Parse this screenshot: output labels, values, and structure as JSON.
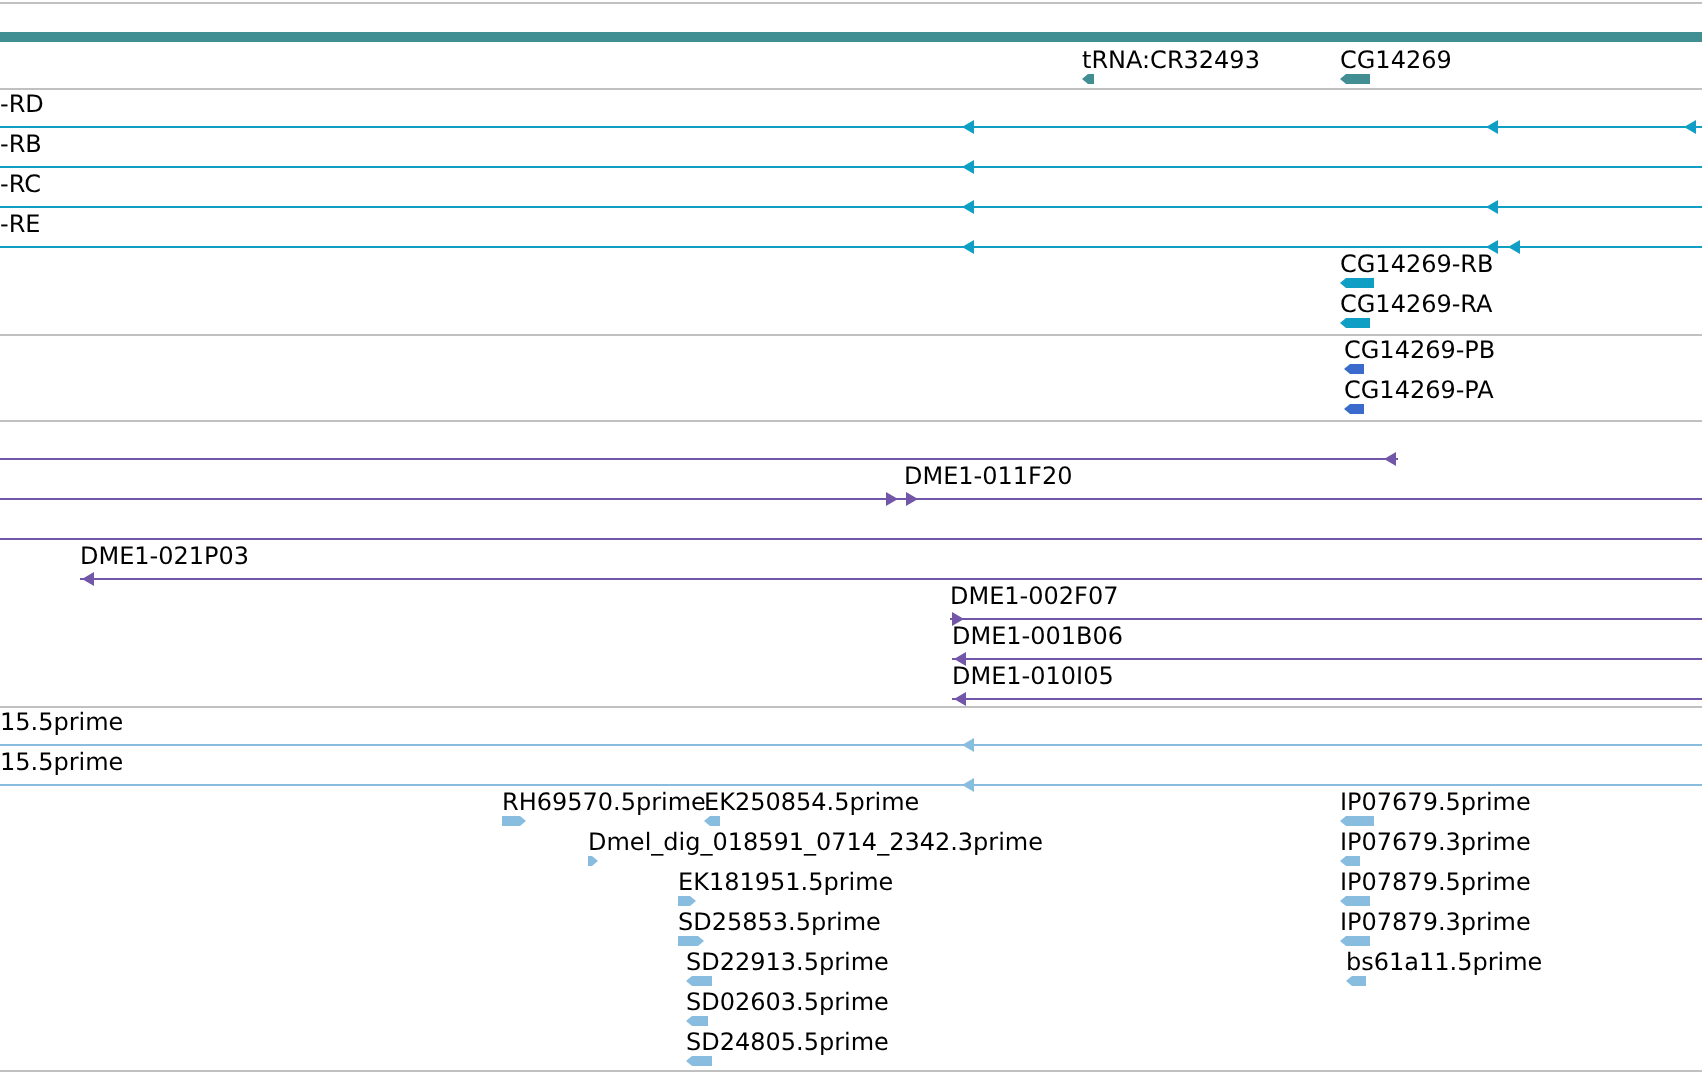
{
  "tracks": [
    {
      "kind": "gene",
      "features": [
        {
          "kind": "block",
          "label": "tRNA:CR32493",
          "reverse": true
        },
        {
          "kind": "block",
          "label": "CG14269",
          "reverse": true
        }
      ]
    },
    {
      "kind": "transcript",
      "features": [
        {
          "kind": "line",
          "label": "-RD",
          "reverse": true
        },
        {
          "kind": "line",
          "label": "-RB",
          "reverse": true
        },
        {
          "kind": "line",
          "label": "-RC",
          "reverse": true
        },
        {
          "kind": "line",
          "label": "-RE",
          "reverse": true
        },
        {
          "kind": "block",
          "label": "CG14269-RB",
          "reverse": true
        },
        {
          "kind": "block",
          "label": "CG14269-RA",
          "reverse": true
        }
      ]
    },
    {
      "kind": "protein",
      "features": [
        {
          "kind": "block",
          "label": "CG14269-PB",
          "reverse": true
        },
        {
          "kind": "block",
          "label": "CG14269-PA",
          "reverse": true
        }
      ]
    },
    {
      "kind": "clone",
      "features": [
        {
          "kind": "line",
          "reverse": true
        },
        {
          "kind": "line",
          "label": "DME1-011F20",
          "reverse": false
        },
        {
          "kind": "line"
        },
        {
          "kind": "line",
          "label": "DME1-021P03",
          "reverse": true
        },
        {
          "kind": "line",
          "label": "DME1-002F07",
          "reverse": false
        },
        {
          "kind": "line",
          "label": "DME1-001B06",
          "reverse": true
        },
        {
          "kind": "line",
          "label": "DME1-010I05",
          "reverse": true
        }
      ]
    },
    {
      "kind": "est",
      "features": [
        {
          "kind": "line",
          "label": "15.5prime",
          "reverse": true
        },
        {
          "kind": "line",
          "label": "15.5prime",
          "reverse": true
        },
        {
          "kind": "block",
          "label": "RH69570.5prime",
          "reverse": false
        },
        {
          "kind": "block",
          "label": "EK250854.5prime",
          "reverse": true
        },
        {
          "kind": "block",
          "label": "Dmel_dig_018591_0714_2342.3prime",
          "reverse": false
        },
        {
          "kind": "block",
          "label": "EK181951.5prime",
          "reverse": false
        },
        {
          "kind": "block",
          "label": "SD25853.5prime",
          "reverse": false
        },
        {
          "kind": "block",
          "label": "SD22913.5prime",
          "reverse": true
        },
        {
          "kind": "block",
          "label": "SD02603.5prime",
          "reverse": true
        },
        {
          "kind": "block",
          "label": "SD24805.5prime",
          "reverse": true
        },
        {
          "kind": "block",
          "label": "IP07679.5prime",
          "reverse": true
        },
        {
          "kind": "block",
          "label": "IP07679.3prime",
          "reverse": true
        },
        {
          "kind": "block",
          "label": "IP07879.5prime",
          "reverse": true
        },
        {
          "kind": "block",
          "label": "IP07879.3prime",
          "reverse": true
        },
        {
          "kind": "block",
          "label": "bs61a11.5prime",
          "reverse": true
        }
      ]
    }
  ]
}
